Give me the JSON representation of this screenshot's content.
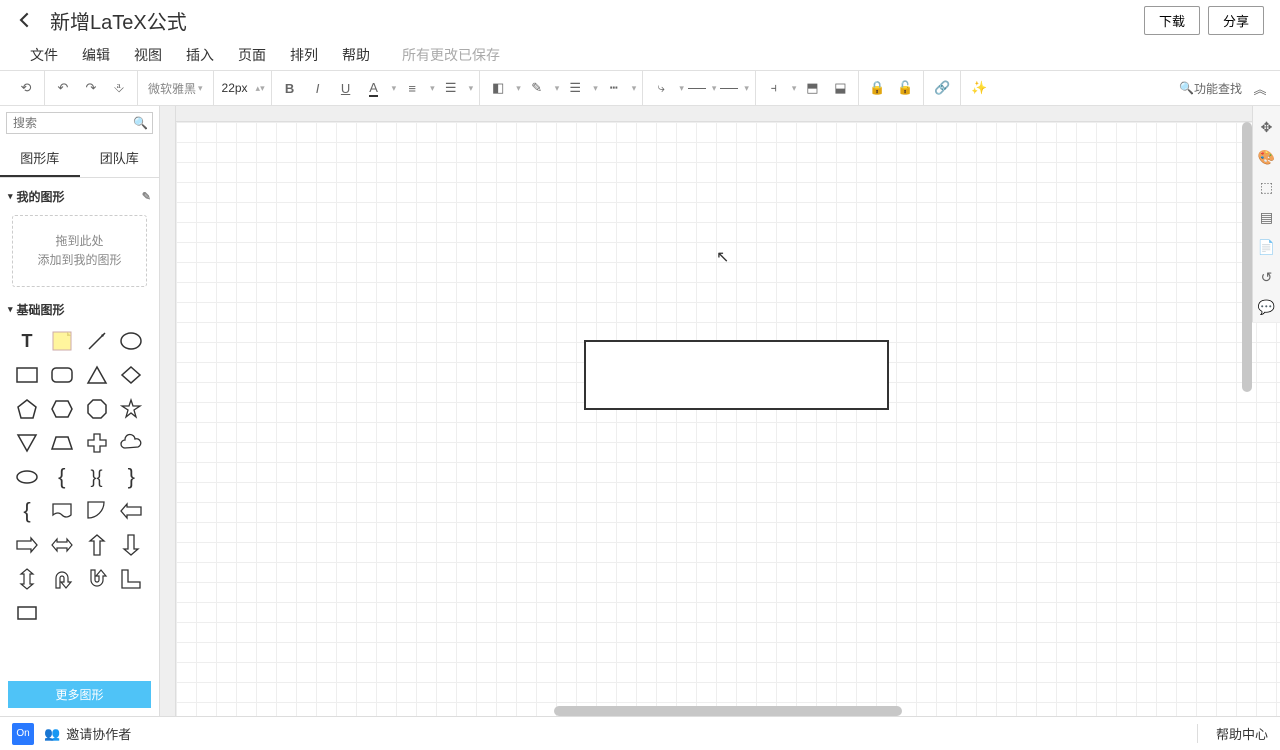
{
  "header": {
    "title": "新增LaTeX公式",
    "download": "下载",
    "share": "分享"
  },
  "menu": {
    "file": "文件",
    "edit": "编辑",
    "view": "视图",
    "insert": "插入",
    "page": "页面",
    "arrange": "排列",
    "help": "帮助",
    "save_status": "所有更改已保存"
  },
  "toolbar": {
    "font_name": "微软雅黑",
    "font_size": "22px",
    "search_label": "功能查找"
  },
  "sidebar": {
    "search_placeholder": "搜索",
    "tab_shapes": "图形库",
    "tab_team": "团队库",
    "my_shapes": "我的图形",
    "drop_line1": "拖到此处",
    "drop_line2": "添加到我的图形",
    "basic_shapes": "基础图形",
    "more_shapes": "更多图形"
  },
  "footer": {
    "online": "On",
    "invite": "邀请协作者",
    "help_center": "帮助中心"
  }
}
